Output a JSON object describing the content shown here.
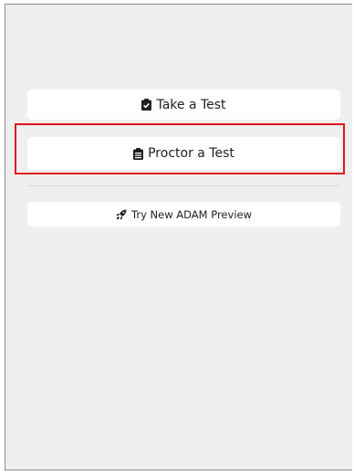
{
  "buttons": {
    "take_test": {
      "label": "Take a Test",
      "icon": "clipboard-check-icon"
    },
    "proctor_test": {
      "label": "Proctor a Test",
      "icon": "clipboard-list-icon"
    },
    "adam_preview": {
      "label": "Try New ADAM Preview",
      "icon": "rocket-icon"
    }
  },
  "colors": {
    "background": "#efefef",
    "button": "#ffffff",
    "text": "#1f1f1f",
    "highlight": "#e0141c"
  }
}
